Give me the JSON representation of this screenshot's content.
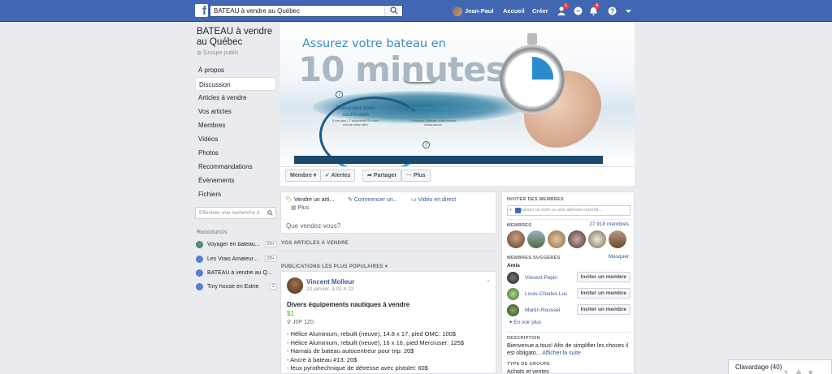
{
  "topbar": {
    "search_value": "BATEAU à vendre au Québec",
    "user_name": "Jean-Paul",
    "home": "Accueil",
    "create": "Créer",
    "friend_badge": "1",
    "notif_badge": "4"
  },
  "group": {
    "title": "BATEAU à vendre au Québec",
    "type": "Groupe public"
  },
  "leftnav": [
    "À propos",
    "Discussion",
    "Articles à vendre",
    "Vos articles",
    "Membres",
    "Vidéos",
    "Photos",
    "Recommandations",
    "Évènements",
    "Fichiers"
  ],
  "group_search_placeholder": "Effectuer une recherche d",
  "shortcuts": {
    "heading": "Raccourcis",
    "items": [
      {
        "label": "Voyager en bateau...",
        "count": "20+"
      },
      {
        "label": "Les Vrais Amateur...",
        "count": "20+"
      },
      {
        "label": "BATEAU à vendre au Q...",
        "count": ""
      },
      {
        "label": "Tiny house en Estrie",
        "count": "2"
      }
    ]
  },
  "cover": {
    "headline": "Assurez votre bateau en",
    "big": "10 minutes",
    "step1_title": "Demandez votre soumission",
    "step1_sub": "5 minutes | 7 assureurs On vous envoie votre offre",
    "step2_title": "Demandez l'émission du contrat",
    "step2_sub": "5 minutes Obtenez votre preuve d'assurance",
    "dot1": "1",
    "dot2": "2"
  },
  "actions": {
    "member": "Membre ▾",
    "alerts": "✓ Alertes",
    "share": "➦ Partager",
    "more": "··· Plus"
  },
  "composer": {
    "sell": "Vendre un arti...",
    "discuss": "Commencer un...",
    "live": "Vidéo en direct",
    "more": "Plus",
    "placeholder": "Que vendez-vous?"
  },
  "sections": {
    "your_items": "VOS ARTICLES À VENDRE",
    "popular": "PUBLICATIONS LES PLUS POPULAIRES ▾"
  },
  "post": {
    "author": "Vincent Molleur",
    "date": "22 janvier, à 01 h 22",
    "title": "Divers équipements nautiques à vendre",
    "price": "$1",
    "location": "J0P 1Z0",
    "lines": [
      "- Hélice Aluminium, rebuilt (neuve), 14.8 x 17, pied OMC: 100$",
      "- Hélice Aluminium, rebuilt (neuve), 16 x 16, pied Mercruser: 125$",
      "- Harnais de bateau autocentreur pour trip: 20$",
      "- Ancre à bateau #13: 20$",
      "- feux pyrothechnique de détresse avec pistolet: 60$"
    ]
  },
  "right": {
    "invite_h": "INVITER DES MEMBRES",
    "invite_ph": "Saisissez un nom ou une adresse courriel...",
    "members_h": "MEMBRES",
    "members_count": "27 918 membres",
    "suggested_h": "MEMBRES SUGGÉRÉS",
    "hide": "Masquer",
    "friends": "Amis",
    "suggestions": [
      {
        "name": "Vincent Pepin",
        "button": "Inviter un membre"
      },
      {
        "name": "Louis-Charles Luc",
        "button": "Inviter un membre"
      },
      {
        "name": "Martin Roussel",
        "button": "Inviter un membre"
      }
    ],
    "see_more": "En voir plus",
    "desc_h": "DESCRIPTION",
    "desc": "Bienvenue a tous! Afin de simplifier les choses il est obligato...",
    "desc_more": "Afficher la suite",
    "type_h": "TYPE DE GROUPE",
    "type": "Achats et ventes"
  },
  "chat": {
    "label": "Clavardage (40)"
  }
}
